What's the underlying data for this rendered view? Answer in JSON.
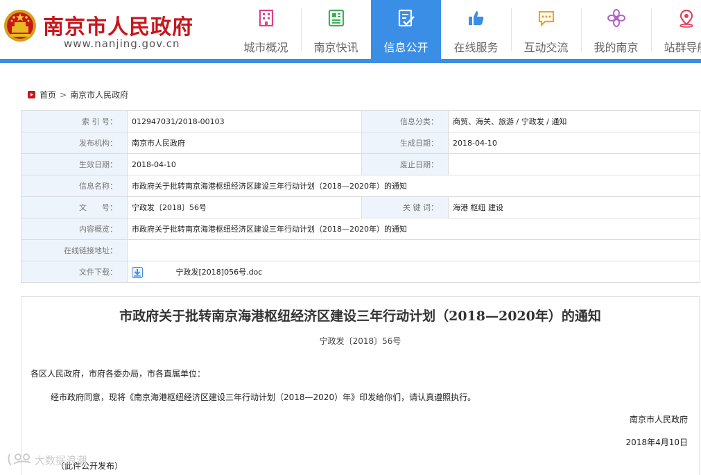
{
  "header": {
    "site_title": "南京市人民政府",
    "site_url": "www.nanjing.gov.cn",
    "logo_icon": "national-emblem-icon",
    "accent_color": "#3a8ee6",
    "brand_color": "#c8161d",
    "nav": [
      {
        "label": "城市概况",
        "icon": "building-icon",
        "icon_color": "#e0408a",
        "active": false
      },
      {
        "label": "南京快讯",
        "icon": "newspaper-icon",
        "icon_color": "#3fae5a",
        "active": false
      },
      {
        "label": "信息公开",
        "icon": "document-edit-icon",
        "icon_color": "#ffffff",
        "active": true
      },
      {
        "label": "在线服务",
        "icon": "thumbs-up-icon",
        "icon_color": "#3a8ee6",
        "active": false
      },
      {
        "label": "互动交流",
        "icon": "chat-icon",
        "icon_color": "#f3a21a",
        "active": false
      },
      {
        "label": "我的南京",
        "icon": "flower-icon",
        "icon_color": "#b062c8",
        "active": false
      },
      {
        "label": "站群导航",
        "icon": "map-pin-icon",
        "icon_color": "#e0405a",
        "active": false
      }
    ]
  },
  "breadcrumb": {
    "home": "首页",
    "separator": ">",
    "current": "南京市人民政府"
  },
  "info": {
    "index_label": "索 引 号：",
    "index_value": "012947031/2018-00103",
    "category_label": "信息分类：",
    "category_value": "商贸、海关、旅游 / 宁政发 / 通知",
    "publisher_label": "发布机构：",
    "publisher_value": "南京市人民政府",
    "created_label": "生成日期：",
    "created_value": "2018-04-10",
    "effective_label": "生效日期：",
    "effective_value": "2018-04-10",
    "abolished_label": "废止日期：",
    "abolished_value": "",
    "name_label": "信息名称：",
    "name_value": "市政府关于批转南京海港枢纽经济区建设三年行动计划（2018—2020年）的通知",
    "docno_label": "文　　号：",
    "docno_value": "宁政发〔2018〕56号",
    "keywords_label": "关 键 词：",
    "keywords_value": "海港 枢纽 建设",
    "summary_label": "内容概览：",
    "summary_value": "市政府关于批转南京海港枢纽经济区建设三年行动计划（2018—2020年）的通知",
    "link_label": "在线链接地址：",
    "link_value": "",
    "download_label": "文件下载：",
    "download_icon": "download-icon",
    "download_file": "宁政发[2018]056号.doc"
  },
  "article": {
    "title": "市政府关于批转南京海港枢纽经济区建设三年行动计划（2018—2020年）的通知",
    "doc_number": "宁政发〔2018〕56号",
    "addressee": "各区人民政府，市府各委办局，市各直属单位：",
    "body": "经市政府同意，现将《南京海港枢纽经济区建设三年行动计划（2018—2020）年》印发给你们，请认真遵照执行。",
    "signature": "南京市人民政府",
    "date": "2018年4月10日",
    "note": "（此件公开发布）"
  },
  "watermark": {
    "text": "大数据浪潮"
  }
}
